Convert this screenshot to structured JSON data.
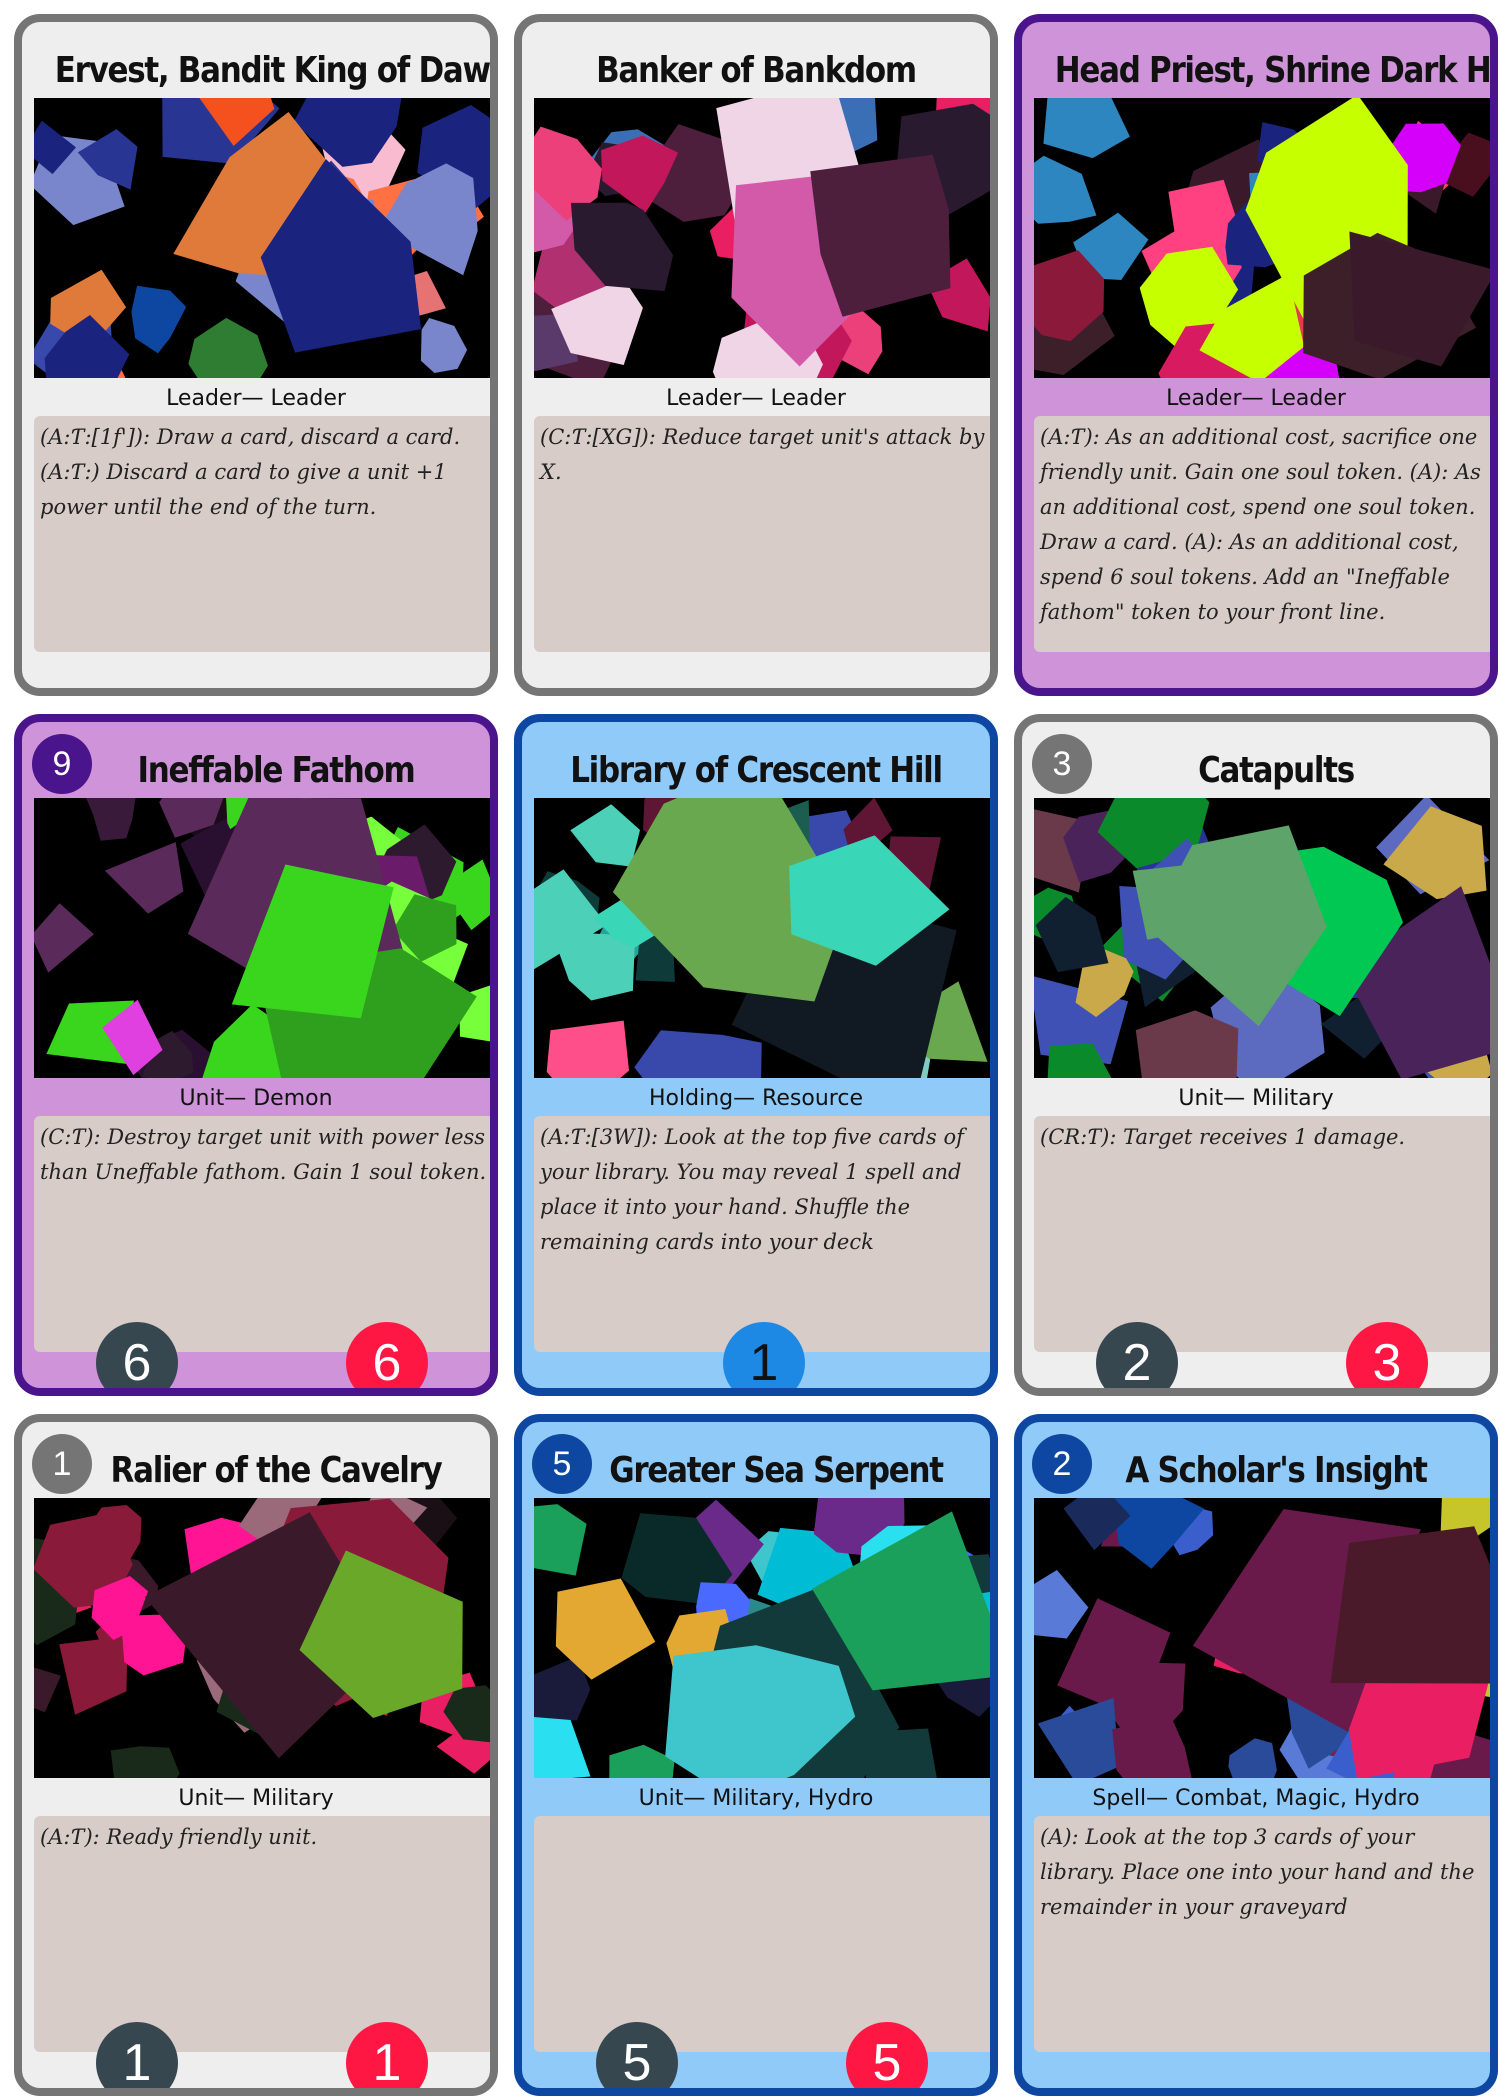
{
  "colors": {
    "neutral_border": "#757575",
    "neutral_bg": "#eeeeee",
    "purple_border": "#4a148c",
    "purple_bg": "#ce93d8",
    "blue_border": "#0d47a1",
    "blue_bg": "#90caf9",
    "rules_bg": "#d7ccc8",
    "power_badge": "#37474f",
    "health_badge": "#ff1744",
    "resource_badge": "#1e88e5"
  },
  "cards": [
    {
      "title": "Ervest, Bandit King of Dawnset",
      "theme": "neutral",
      "type_line": "Leader— Leader",
      "rules": "(A:Ƭ:[1f']): Draw a card, discard a card. (A:Ƭ:) Discard a card to give a unit +1 power until the end of the turn.",
      "palette": [
        "#e57373",
        "#f4511e",
        "#3949ab",
        "#1a237e",
        "#0d47a1",
        "#ff7043",
        "#2e7d32",
        "#7986cb",
        "#f8bbd0",
        "#283593",
        "#8e2456",
        "#e07a3a"
      ]
    },
    {
      "title": "Banker of Bankdom",
      "theme": "neutral",
      "type_line": "Leader— Leader",
      "rules": "(C:Ƭ:[XG]): Reduce target unit's attack by X.",
      "palette": [
        "#c2185b",
        "#ec407a",
        "#3a6fb5",
        "#4e1f3d",
        "#1b1b2f",
        "#e91e63",
        "#9fb0b8",
        "#efd5e6",
        "#b03070",
        "#2a1a30",
        "#5a3a6a",
        "#d35aa8"
      ]
    },
    {
      "title": "Head Priest, Shrine Dark Hearts",
      "theme": "purple",
      "type_line": "Leader— Leader",
      "rules": "(A:Ƭ): As an additional cost, sacrifice one friendly unit. Gain one soul token. (A): As an additional cost, spend one soul token. Draw a card. (A): As an additional cost, spend 6 soul tokens. Add an \"Ineffable fathom\" token to your front line.",
      "palette": [
        "#4a0f1e",
        "#8b1a3a",
        "#d81b60",
        "#3a1a2a",
        "#5c1a2e",
        "#e53950",
        "#2e86c1",
        "#c6ff00",
        "#d500f9",
        "#1a237e",
        "#ff4081",
        "#3d1f2a"
      ]
    },
    {
      "title": "Ineffable Fathom",
      "theme": "purple",
      "cost": "9",
      "type_line": "Unit— Demon",
      "rules": "(C:Ƭ): Destroy target unit with power less than Uneffable fathom. Gain 1 soul token.",
      "power": "6",
      "health": "6",
      "palette": [
        "#4a0e4e",
        "#6a1b6a",
        "#2e1a2e",
        "#3ad61e",
        "#76ff3a",
        "#e040e0",
        "#2a1030",
        "#5a2a5a",
        "#8a1a8a",
        "#1a0a1a",
        "#3a1a3a",
        "#2fa01e"
      ]
    },
    {
      "title": "Library of Crescent Hill",
      "theme": "blue",
      "type_line": "Holding— Resource",
      "rules": "(A:Ƭ:[3W]): Look at the top five cards of your library. You may reveal 1 spell and place it into your hand. Shuffle the remaining cards into your deck",
      "resource": "1",
      "palette": [
        "#ff4f8b",
        "#5e1634",
        "#14e0b8",
        "#3ad6b8",
        "#26a69a",
        "#1b5e50",
        "#3949ab",
        "#111a22",
        "#4dd0b8",
        "#80cbc4",
        "#0f3a3a",
        "#6aa84f"
      ]
    },
    {
      "title": "Catapults",
      "theme": "neutral",
      "cost": "3",
      "type_line": "Unit— Military",
      "rules": "(CR:Ƭ): Target receives 1 damage.",
      "power": "2",
      "health": "3",
      "palette": [
        "#5c6bc0",
        "#283593",
        "#1a237e",
        "#5ea36a",
        "#0a8a2a",
        "#c9a94a",
        "#3f51b5",
        "#4a235a",
        "#102030",
        "#6a3a4a",
        "#1e88e5",
        "#00c853"
      ]
    },
    {
      "title": "Ralier of the Cavelry",
      "theme": "neutral",
      "cost": "1",
      "type_line": "Unit— Military",
      "rules": "(A:Ƭ): Ready friendly unit.",
      "power": "1",
      "health": "1",
      "palette": [
        "#ff1493",
        "#b0324a",
        "#1a0f14",
        "#6aa82a",
        "#9a6a7a",
        "#d4e6b5",
        "#2a8a2a",
        "#8a1a3a",
        "#1a2a1a",
        "#5e8a2a",
        "#e91e63",
        "#3a1a2a"
      ]
    },
    {
      "title": "Greater Sea Serpent",
      "theme": "blue",
      "cost": "5",
      "type_line": "Unit— Military, Hydro",
      "rules": "",
      "power": "5",
      "health": "5",
      "palette": [
        "#e3a832",
        "#1a5a5a",
        "#2ae0f0",
        "#3ec6cc",
        "#1a1a3a",
        "#4a6aff",
        "#6a2a8a",
        "#123a3a",
        "#2a8a8a",
        "#00bcd4",
        "#0a2a2a",
        "#1aa05a"
      ]
    },
    {
      "title": "A Scholar's Insight",
      "theme": "blue",
      "cost": "2",
      "type_line": "Spell— Combat, Magic, Hydro",
      "rules": "(A): Look at the top 3 cards of your library. Place one into your hand and the remainder in your graveyard",
      "palette": [
        "#3a5fcd",
        "#ff1f5a",
        "#1565c0",
        "#4a1a2a",
        "#8a1a3a",
        "#2a4a9a",
        "#c6c62a",
        "#e91e63",
        "#1a2a5a",
        "#5a7ad8",
        "#0d47a1",
        "#6a1a4a"
      ]
    }
  ]
}
